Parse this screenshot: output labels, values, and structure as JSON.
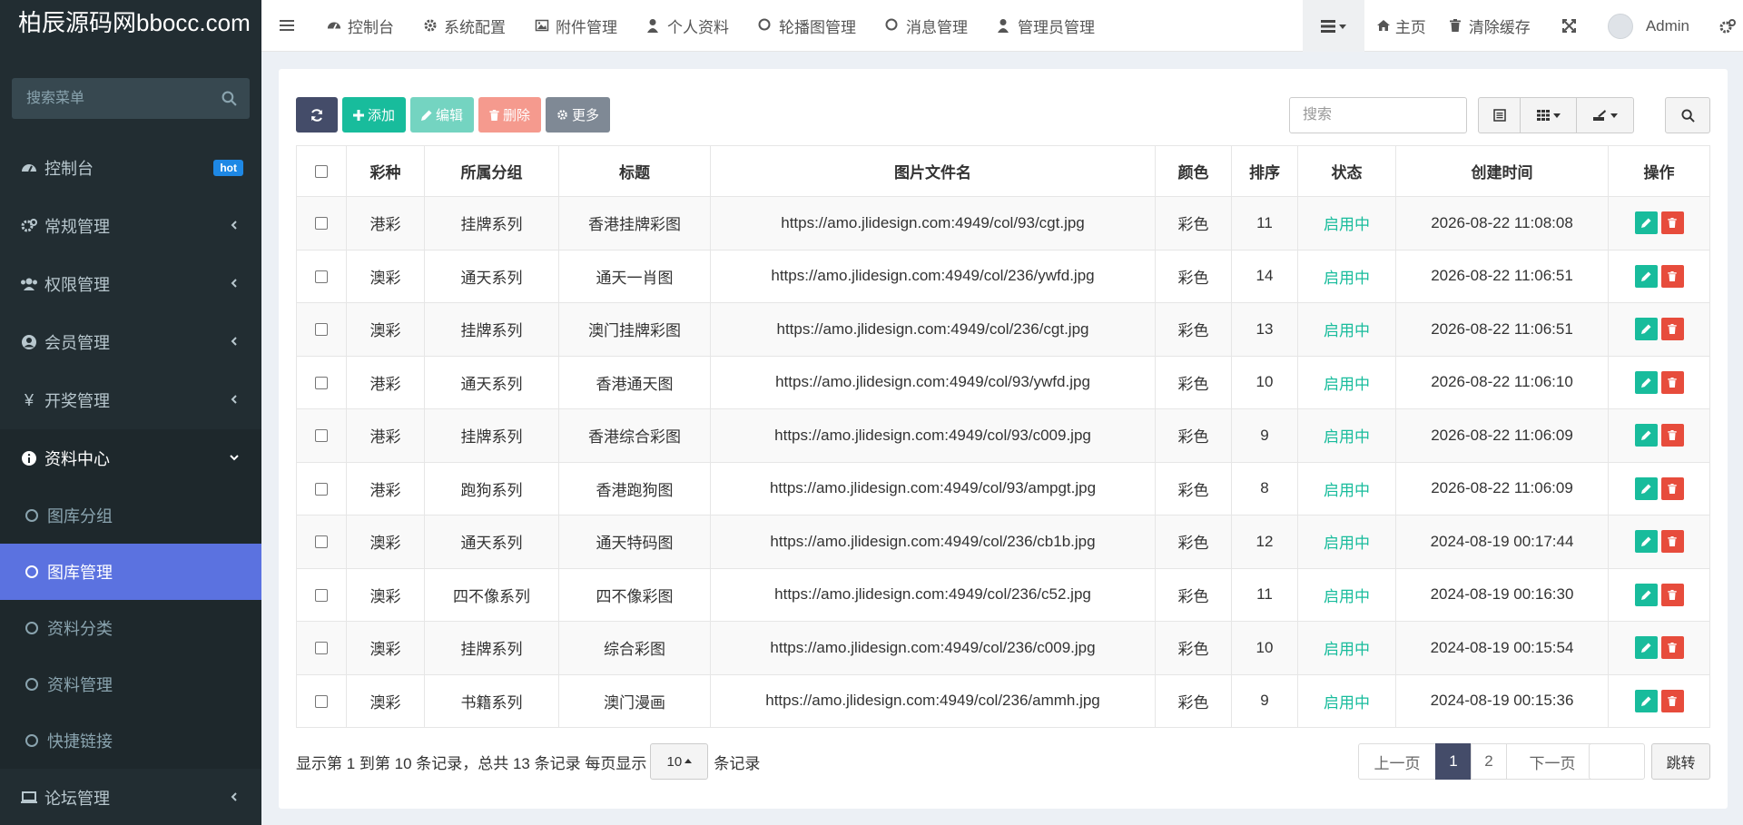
{
  "sidebar": {
    "logo": "柏辰源码网bbocc.com",
    "search_placeholder": "搜索菜单",
    "items": [
      {
        "label": "控制台",
        "badge": "hot",
        "icon": "dashboard-icon"
      },
      {
        "label": "常规管理",
        "icon": "cogs-icon"
      },
      {
        "label": "权限管理",
        "icon": "group-icon"
      },
      {
        "label": "会员管理",
        "icon": "user-circle-icon"
      },
      {
        "label": "开奖管理",
        "icon": "yen-icon"
      },
      {
        "label": "资料中心",
        "icon": "info-icon"
      }
    ],
    "subitems": [
      {
        "label": "图库分组"
      },
      {
        "label": "图库管理"
      },
      {
        "label": "资料分类"
      },
      {
        "label": "资料管理"
      },
      {
        "label": "快捷链接"
      }
    ],
    "bottom_item": {
      "label": "论坛管理",
      "icon": "laptop-icon"
    },
    "active_color": "#5b72e0",
    "bg_color": "#222d32"
  },
  "navbar": {
    "tabs": [
      {
        "label": "控制台",
        "icon": "dashboard-icon"
      },
      {
        "label": "系统配置",
        "icon": "gear-icon"
      },
      {
        "label": "附件管理",
        "icon": "image-icon"
      },
      {
        "label": "个人资料",
        "icon": "user-icon"
      },
      {
        "label": "轮播图管理",
        "icon": "circle-icon"
      },
      {
        "label": "消息管理",
        "icon": "circle-icon"
      },
      {
        "label": "管理员管理",
        "icon": "user-icon"
      }
    ],
    "home": "主页",
    "clear_cache": "清除缓存",
    "admin": "Admin"
  },
  "toolbar": {
    "add": "添加",
    "edit": "编辑",
    "delete": "删除",
    "more": "更多",
    "search_placeholder": "搜索"
  },
  "table": {
    "columns": [
      "彩种",
      "所属分组",
      "标题",
      "图片文件名",
      "颜色",
      "排序",
      "状态",
      "创建时间",
      "操作"
    ],
    "rows": [
      {
        "kind": "港彩",
        "group": "挂牌系列",
        "title": "香港挂牌彩图",
        "file": "https://amo.jlidesign.com:4949/col/93/cgt.jpg",
        "color": "彩色",
        "sort": "11",
        "status": "启用中",
        "time": "2026-08-22 11:08:08"
      },
      {
        "kind": "澳彩",
        "group": "通天系列",
        "title": "通天一肖图",
        "file": "https://amo.jlidesign.com:4949/col/236/ywfd.jpg",
        "color": "彩色",
        "sort": "14",
        "status": "启用中",
        "time": "2026-08-22 11:06:51"
      },
      {
        "kind": "澳彩",
        "group": "挂牌系列",
        "title": "澳门挂牌彩图",
        "file": "https://amo.jlidesign.com:4949/col/236/cgt.jpg",
        "color": "彩色",
        "sort": "13",
        "status": "启用中",
        "time": "2026-08-22 11:06:51"
      },
      {
        "kind": "港彩",
        "group": "通天系列",
        "title": "香港通天图",
        "file": "https://amo.jlidesign.com:4949/col/93/ywfd.jpg",
        "color": "彩色",
        "sort": "10",
        "status": "启用中",
        "time": "2026-08-22 11:06:10"
      },
      {
        "kind": "港彩",
        "group": "挂牌系列",
        "title": "香港综合彩图",
        "file": "https://amo.jlidesign.com:4949/col/93/c009.jpg",
        "color": "彩色",
        "sort": "9",
        "status": "启用中",
        "time": "2026-08-22 11:06:09"
      },
      {
        "kind": "港彩",
        "group": "跑狗系列",
        "title": "香港跑狗图",
        "file": "https://amo.jlidesign.com:4949/col/93/ampgt.jpg",
        "color": "彩色",
        "sort": "8",
        "status": "启用中",
        "time": "2026-08-22 11:06:09"
      },
      {
        "kind": "澳彩",
        "group": "通天系列",
        "title": "通天特码图",
        "file": "https://amo.jlidesign.com:4949/col/236/cb1b.jpg",
        "color": "彩色",
        "sort": "12",
        "status": "启用中",
        "time": "2024-08-19 00:17:44"
      },
      {
        "kind": "澳彩",
        "group": "四不像系列",
        "title": "四不像彩图",
        "file": "https://amo.jlidesign.com:4949/col/236/c52.jpg",
        "color": "彩色",
        "sort": "11",
        "status": "启用中",
        "time": "2024-08-19 00:16:30"
      },
      {
        "kind": "澳彩",
        "group": "挂牌系列",
        "title": "综合彩图",
        "file": "https://amo.jlidesign.com:4949/col/236/c009.jpg",
        "color": "彩色",
        "sort": "10",
        "status": "启用中",
        "time": "2024-08-19 00:15:54"
      },
      {
        "kind": "澳彩",
        "group": "书籍系列",
        "title": "澳门漫画",
        "file": "https://amo.jlidesign.com:4949/col/236/ammh.jpg",
        "color": "彩色",
        "sort": "9",
        "status": "启用中",
        "time": "2024-08-19 00:15:36"
      }
    ]
  },
  "footer": {
    "info_prefix": "显示第 1 到第 10 条记录，总共 13 条记录 每页显示",
    "page_size": "10",
    "info_suffix": "条记录"
  },
  "pagination": {
    "prev": "上一页",
    "pages": [
      "1",
      "2"
    ],
    "current": "1",
    "next": "下一页",
    "jump": "跳转"
  },
  "colors": {
    "accent": "#18bc9c",
    "danger": "#e74c3c",
    "primary": "#444c69"
  }
}
